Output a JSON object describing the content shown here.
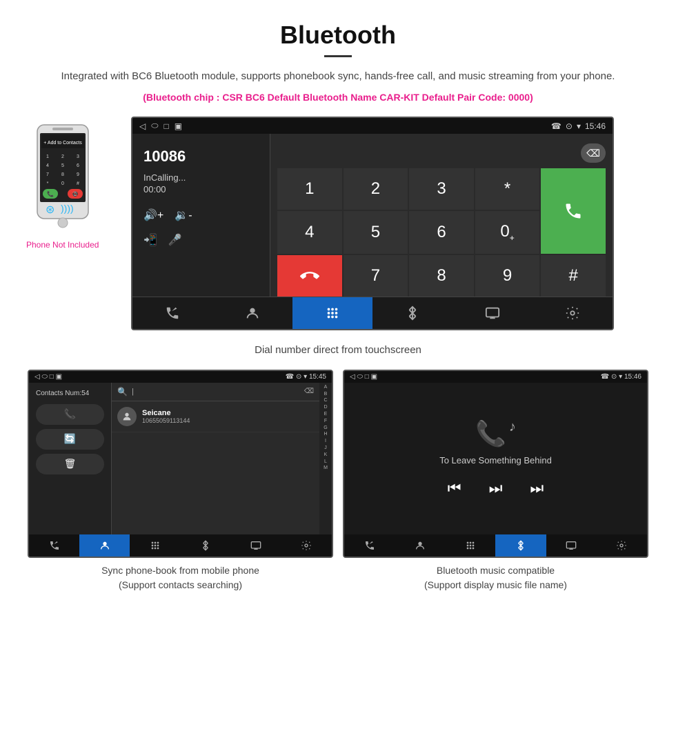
{
  "header": {
    "title": "Bluetooth",
    "description": "Integrated with BC6 Bluetooth module, supports phonebook sync, hands-free call, and music streaming from your phone.",
    "specs": "(Bluetooth chip : CSR BC6    Default Bluetooth Name CAR-KIT    Default Pair Code: 0000)"
  },
  "main_screen": {
    "status_bar": {
      "left": [
        "◁",
        "⬭",
        "□",
        "▣▣"
      ],
      "right": "☎ ⊙ ▾ 15:46",
      "time": "15:46"
    },
    "dial_info": {
      "number": "10086",
      "calling": "InCalling...",
      "timer": "00:00"
    },
    "keys": [
      "1",
      "2",
      "3",
      "*",
      "4",
      "5",
      "6",
      "0+",
      "7",
      "8",
      "9",
      "#"
    ],
    "caption": "Dial number direct from touchscreen"
  },
  "contacts_screen": {
    "status_bar_time": "15:45",
    "contacts_num": "Contacts Num:54",
    "contact": {
      "name": "Seicane",
      "number": "10655059113144"
    },
    "alpha_letters": [
      "A",
      "B",
      "C",
      "D",
      "E",
      "F",
      "G",
      "H",
      "I",
      "J",
      "K",
      "L",
      "M"
    ],
    "caption": "Sync phone-book from mobile phone\n(Support contacts searching)"
  },
  "music_screen": {
    "status_bar_time": "15:46",
    "song_title": "To Leave Something Behind",
    "caption": "Bluetooth music compatible\n(Support display music file name)"
  }
}
